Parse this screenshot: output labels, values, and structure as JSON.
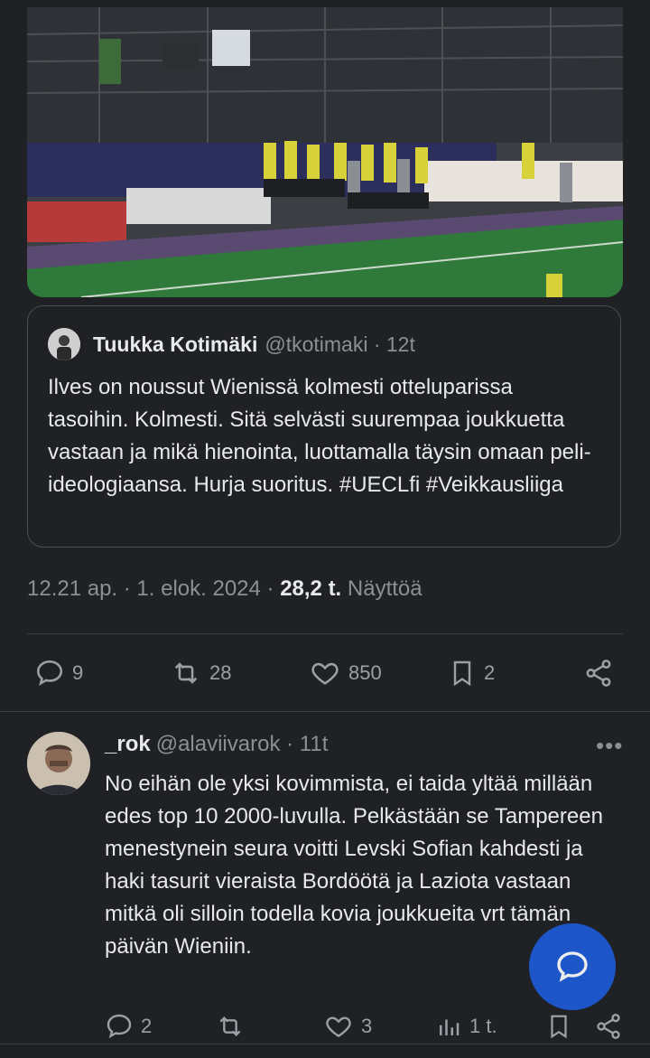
{
  "media": {
    "description_icon": "match-photo"
  },
  "quote": {
    "name": "Tuukka Kotimäki",
    "handle": "@tkotimaki · 12t",
    "text": "Ilves on noussut Wienissä kolmesti otteluparissa tasoihin. Kolmesti. Sitä selvästi suurempaa joukkuetta vastaan ja mikä hienointa, luottamalla täysin omaan peli-ideologiaansa. Hurja suoritus. #UECLfi #Veikkausliiga"
  },
  "meta": {
    "time": "12.21 ap. · 1. elok. 2024 · ",
    "views_count": "28,2 t.",
    "views_label": " Näyttöä"
  },
  "actions": {
    "replies": "9",
    "reposts": "28",
    "likes": "850",
    "bookmarks": "2"
  },
  "reply": {
    "name": "_rok",
    "handle": "@alaviivarok · 11t",
    "text": "No eihän ole yksi kovimmista, ei taida yltää millään edes top 10 2000-luvulla. Pelkästään se Tampereen menestynein seura voitti Levski Sofian kahdesti ja haki tasurit vieraista Bordöötä ja Laziota vastaan mitkä oli silloin todella kovia joukkueita vrt tämän päivän Wieniin.",
    "more": "•••",
    "actions": {
      "replies": "2",
      "reposts": "",
      "likes": "3",
      "views": "1 t."
    }
  }
}
